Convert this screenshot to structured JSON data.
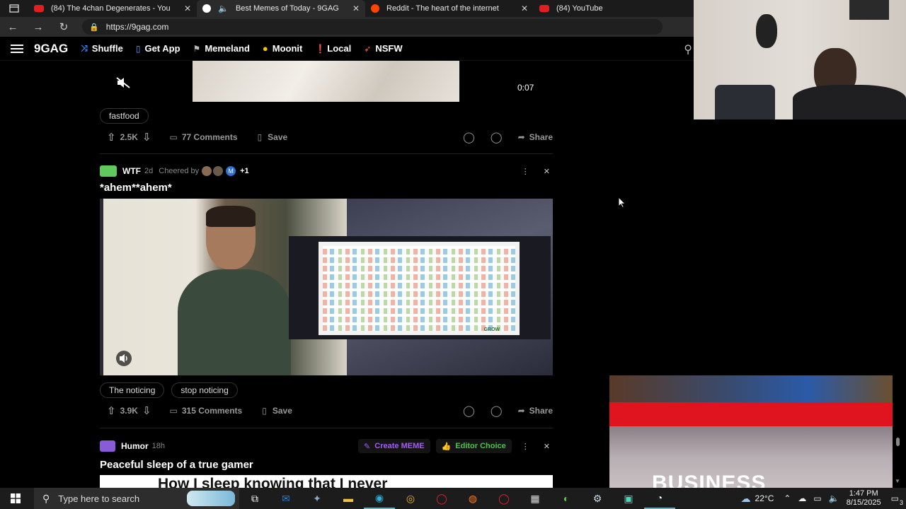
{
  "browser": {
    "tabs": [
      {
        "title": "(84) The 4chan Degenerates - You",
        "favicon_color": "#e02020",
        "active": false
      },
      {
        "title": "Best Memes of Today - 9GAG",
        "favicon_color": "#222222",
        "active": true
      },
      {
        "title": "Reddit - The heart of the internet",
        "favicon_color": "#ff4500",
        "active": false
      },
      {
        "title": "(84) YouTube",
        "favicon_color": "#e02020",
        "active": false
      }
    ],
    "url": "https://9gag.com"
  },
  "site": {
    "logo": "9GAG",
    "nav": [
      {
        "label": "Shuffle",
        "icon": "shuffle-icon",
        "icon_glyph": "⤨",
        "color": "#3d8bff"
      },
      {
        "label": "Get App",
        "icon": "phone-icon",
        "icon_glyph": "▯",
        "color": "#5ba3ff"
      },
      {
        "label": "Memeland",
        "icon": "flag-icon",
        "icon_glyph": "⚑",
        "color": "#bbbbbb"
      },
      {
        "label": "Moonit",
        "icon": "moon-icon",
        "icon_glyph": "●",
        "color": "#f5c400"
      },
      {
        "label": "Local",
        "icon": "pin-icon",
        "icon_glyph": "📍",
        "color": "#ff3b3b"
      },
      {
        "label": "NSFW",
        "icon": "rocket-icon",
        "icon_glyph": "➶",
        "color": "#ff6a3d"
      }
    ]
  },
  "posts": {
    "first": {
      "duration": "0:07",
      "tags": [
        "fastfood"
      ],
      "upvotes": "2.5K",
      "comments": "77 Comments",
      "save": "Save",
      "share": "Share"
    },
    "second": {
      "section": "WTF",
      "age": "2d",
      "cheered_by": "Cheered by",
      "cheer_extra": "+1",
      "cheer_initial": "M",
      "title": "*ahem**ahem*",
      "tags": [
        "The noticing",
        "stop noticing"
      ],
      "upvotes": "3.9K",
      "comments": "315 Comments",
      "save": "Save",
      "share": "Share",
      "video_footer": "GROW"
    },
    "third": {
      "section": "Humor",
      "age": "18h",
      "create_meme": "Create MEME",
      "editor_choice": "Editor Choice",
      "title": "Peaceful sleep of a true gamer",
      "image_text": "How I sleep knowing that I never"
    }
  },
  "ad": {
    "text": "BUSINESS"
  },
  "taskbar": {
    "search_placeholder": "Type here to search",
    "weather": "22°C",
    "time": "1:47 PM",
    "date": "8/15/2025",
    "notif_count": "3"
  },
  "colors": {
    "accent_green": "#5fc85f",
    "create_meme": "#a15bff",
    "editor_choice": "#4cc24c",
    "ad_red": "#e0141e"
  }
}
